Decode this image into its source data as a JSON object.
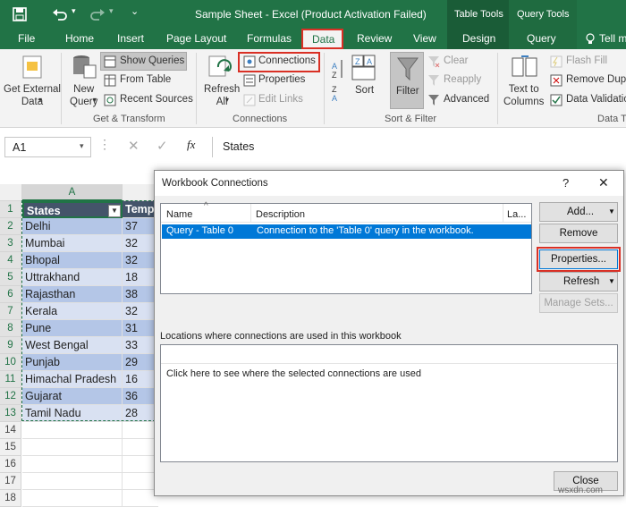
{
  "titlebar": {
    "title": "Sample Sheet - Excel (Product Activation Failed)",
    "table_tools": "Table Tools",
    "query_tools": "Query Tools"
  },
  "tabs": [
    "File",
    "Home",
    "Insert",
    "Page Layout",
    "Formulas",
    "Data",
    "Review",
    "View",
    "Design",
    "Query",
    "Tell m"
  ],
  "ribbon": {
    "get_external_data": "Get External\nData",
    "new_query": "New\nQuery",
    "show_queries": "Show Queries",
    "from_table": "From Table",
    "recent_sources": "Recent Sources",
    "get_transform": "Get & Transform",
    "refresh_all": "Refresh\nAll",
    "connections": "Connections",
    "properties": "Properties",
    "edit_links": "Edit Links",
    "connections_group": "Connections",
    "sort": "Sort",
    "filter": "Filter",
    "clear": "Clear",
    "reapply": "Reapply",
    "advanced": "Advanced",
    "sort_filter": "Sort & Filter",
    "text_to_columns": "Text to\nColumns",
    "flash_fill": "Flash Fill",
    "remove_dup": "Remove Dupl",
    "data_validation": "Data Validatio",
    "data_tools": "Data T"
  },
  "formula": {
    "namebox": "A1",
    "content": "States"
  },
  "sheet": {
    "col_a": "A",
    "header_a": "States",
    "header_b": "Temp",
    "rows": [
      [
        "Delhi",
        "37"
      ],
      [
        "Mumbai",
        "32"
      ],
      [
        "Bhopal",
        "32"
      ],
      [
        "Uttrakhand",
        "18"
      ],
      [
        "Rajasthan",
        "38"
      ],
      [
        "Kerala",
        "32"
      ],
      [
        "Pune",
        "31"
      ],
      [
        "West Bengal",
        "33"
      ],
      [
        "Punjab",
        "29"
      ],
      [
        "Himachal Pradesh",
        "16"
      ],
      [
        "Gujarat",
        "36"
      ],
      [
        "Tamil Nadu",
        "28"
      ]
    ],
    "row_numbers": [
      "1",
      "2",
      "3",
      "4",
      "5",
      "6",
      "7",
      "8",
      "9",
      "10",
      "11",
      "12",
      "13",
      "14",
      "15",
      "16",
      "17",
      "18"
    ]
  },
  "dialog": {
    "title": "Workbook Connections",
    "help": "?",
    "close_x": "✕",
    "col_name": "Name",
    "col_desc": "Description",
    "col_last": "La...",
    "conn_name": "Query - Table 0",
    "conn_desc": "Connection to the 'Table 0' query in the workbook.",
    "add": "Add...",
    "remove": "Remove",
    "properties": "Properties...",
    "refresh": "Refresh",
    "manage_sets": "Manage Sets...",
    "locations_label": "Locations where connections are used in this workbook",
    "locations_hint": "Click here to see where the selected connections are used",
    "close": "Close"
  },
  "watermark": "wsxdn.com",
  "colors": {
    "excel_green": "#217346",
    "selection_blue": "#0078d7",
    "highlight_red": "#d93025",
    "table_header": "#44546a",
    "table_band": "#b4c6e7"
  }
}
